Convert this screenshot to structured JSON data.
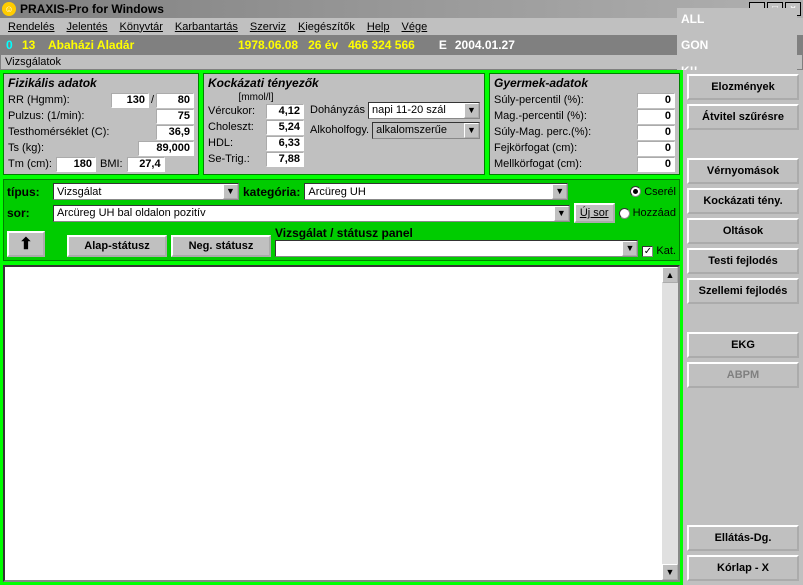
{
  "title": "PRAXIS-Pro for Windows",
  "menu": [
    "Rendelés",
    "Jelentés",
    "Könyvtár",
    "Karbantartás",
    "Szerviz",
    "Kiegészítők",
    "Help",
    "Vége"
  ],
  "info": {
    "id0": "0",
    "id1": "13",
    "name": "Abaházi Aladár",
    "dob": "1978.06.08",
    "age": "26 év",
    "ssn": "466 324 566",
    "e": "E",
    "date": "2004.01.27",
    "all": "ALL",
    "gon": "GON",
    "k": "K!!"
  },
  "subbar": "Vizsgálatok",
  "phys": {
    "hdr": "Fizikális adatok",
    "rr_lbl": "RR (Hgmm):",
    "rr1": "130",
    "rr2": "80",
    "pulse_lbl": "Pulzus: (1/min):",
    "pulse": "75",
    "temp_lbl": "Testhomérséklet (C):",
    "temp": "36,9",
    "ts_lbl": "Ts (kg):",
    "ts": "89,000",
    "tm_lbl": "Tm (cm):",
    "tm": "180",
    "bmi_lbl": "BMI:",
    "bmi": "27,4"
  },
  "risk": {
    "hdr": "Kockázati tényezők",
    "unit": "[mmol/l]",
    "vcuk_lbl": "Vércukor:",
    "vcuk": "4,12",
    "chol_lbl": "Choleszt:",
    "chol": "5,24",
    "hdl_lbl": "HDL:",
    "hdl": "6,33",
    "trig_lbl": "Se-Trig.:",
    "trig": "7,88",
    "smoke_lbl": "Dohányzás",
    "smoke": "napi 11-20 szál",
    "alc_lbl": "Alkoholfogy.",
    "alc": "alkalomszerűe"
  },
  "child": {
    "hdr": "Gyermek-adatok",
    "sp_lbl": "Súly-percentil (%):",
    "sp": "0",
    "mp_lbl": "Mag.-percentil (%):",
    "mp": "0",
    "smp_lbl": "Súly-Mag. perc.(%):",
    "smp": "0",
    "fk_lbl": "Fejkörfogat (cm):",
    "fk": "0",
    "mk_lbl": "Mellkörfogat (cm):",
    "mk": "0"
  },
  "mid": {
    "tipus_lbl": "típus:",
    "tipus": "Vizsgálat",
    "kat_lbl": "kategória:",
    "kat": "Arcüreg UH",
    "sor_lbl": "sor:",
    "sor": "Arcüreg UH bal oldalon pozitív",
    "ujsor": "Új sor",
    "cserel": "Cserél",
    "hozzaad": "Hozzáad",
    "alap": "Alap-státusz",
    "neg": "Neg. státusz",
    "panel_lbl": "Vizsgálat / státusz panel",
    "kat_chk": "Kat."
  },
  "rbtns": {
    "eloz": "Elozmények",
    "atv": "Átvitel szűrésre",
    "ver": "Vérnyomások",
    "kock": "Kockázati tény.",
    "olt": "Oltások",
    "testi": "Testi fejlodés",
    "szell": "Szellemi fejlodés",
    "ekg": "EKG",
    "abpm": "ABPM",
    "ell": "Ellátás-Dg.",
    "korlap": "Kórlap - X"
  }
}
